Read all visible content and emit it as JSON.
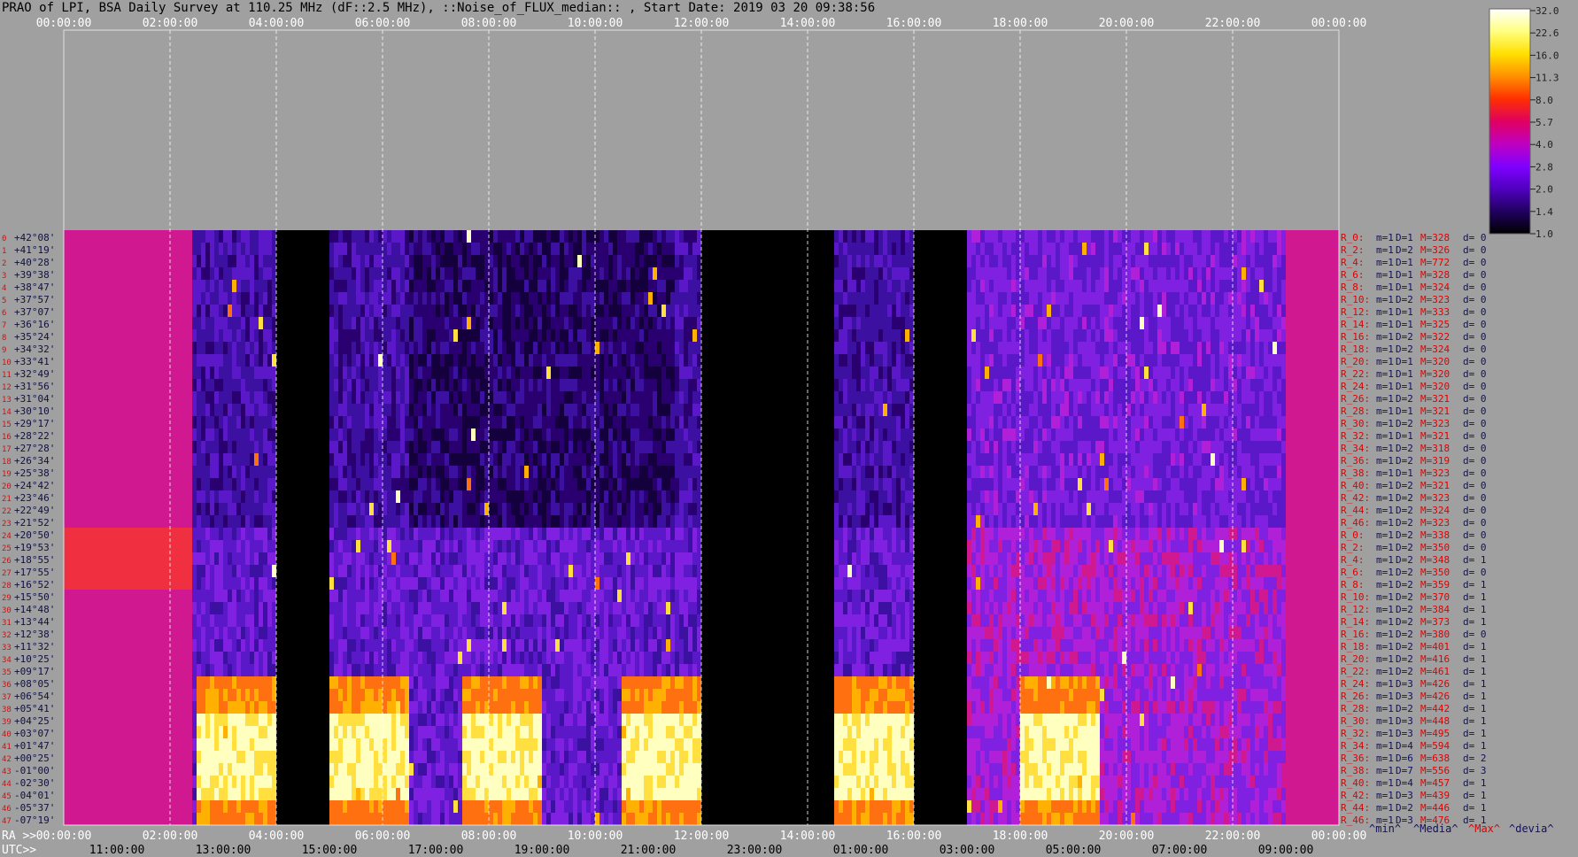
{
  "title": "PRAO of LPI, BSA Daily Survey at 110.25 MHz (dF::2.5 MHz), ::Noise_of_FLUX_median:: , Start Date: 2019 03 20 09:38:56",
  "chart_data": {
    "type": "heatmap",
    "utc_ticks_top": [
      "00:00:00",
      "02:00:00",
      "04:00:00",
      "06:00:00",
      "08:00:00",
      "10:00:00",
      "12:00:00",
      "14:00:00",
      "16:00:00",
      "18:00:00",
      "20:00:00",
      "22:00:00",
      "00:00:00"
    ],
    "ra_prefix": "RA >>",
    "ra_ticks": [
      "00:00:00",
      "02:00:00",
      "04:00:00",
      "06:00:00",
      "08:00:00",
      "10:00:00",
      "12:00:00",
      "14:00:00",
      "16:00:00",
      "18:00:00",
      "20:00:00",
      "22:00:00",
      "00:00:00"
    ],
    "utc_prefix": "UTC>>",
    "utc_ticks_bottom": [
      "11:00:00",
      "13:00:00",
      "15:00:00",
      "17:00:00",
      "19:00:00",
      "21:00:00",
      "23:00:00",
      "01:00:00",
      "03:00:00",
      "05:00:00",
      "07:00:00",
      "09:00:00"
    ],
    "declinations": [
      "+42°08'",
      "+41°19'",
      "+40°28'",
      "+39°38'",
      "+38°47'",
      "+37°57'",
      "+37°07'",
      "+36°16'",
      "+35°24'",
      "+34°32'",
      "+33°41'",
      "+32°49'",
      "+31°56'",
      "+31°04'",
      "+30°10'",
      "+29°17'",
      "+28°22'",
      "+27°28'",
      "+26°34'",
      "+25°38'",
      "+24°42'",
      "+23°46'",
      "+22°49'",
      "+21°52'",
      "+20°50'",
      "+19°53'",
      "+18°55'",
      "+17°55'",
      "+16°52'",
      "+15°50'",
      "+14°48'",
      "+13°44'",
      "+12°38'",
      "+11°32'",
      "+10°25'",
      "+09°17'",
      "+08°05'",
      "+06°54'",
      "+05°41'",
      "+04°25'",
      "+03°07'",
      "+01°47'",
      "+00°25'",
      "-01°00'",
      "-02°30'",
      "-04°01'",
      "-05°37'",
      "-07°19'"
    ],
    "row_indices": [
      "0",
      "1",
      "2",
      "3",
      "4",
      "5",
      "6",
      "7",
      "8",
      "9",
      "10",
      "11",
      "12",
      "13",
      "14",
      "15",
      "16",
      "17",
      "18",
      "19",
      "20",
      "21",
      "22",
      "23",
      "24",
      "25",
      "26",
      "27",
      "28",
      "29",
      "30",
      "31",
      "32",
      "33",
      "34",
      "35",
      "36",
      "37",
      "38",
      "39",
      "40",
      "41",
      "42",
      "43",
      "44",
      "45",
      "46",
      "47"
    ],
    "beam_stats": [
      {
        "r": "R_0:",
        "m": "m=1",
        "D": "D=1",
        "M": "M=328",
        "d": "d= 0"
      },
      {
        "r": "R_2:",
        "m": "m=1",
        "D": "D=2",
        "M": "M=326",
        "d": "d= 0"
      },
      {
        "r": "R_4:",
        "m": "m=1",
        "D": "D=1",
        "M": "M=772",
        "d": "d= 0"
      },
      {
        "r": "R_6:",
        "m": "m=1",
        "D": "D=1",
        "M": "M=328",
        "d": "d= 0"
      },
      {
        "r": "R_8:",
        "m": "m=1",
        "D": "D=1",
        "M": "M=324",
        "d": "d= 0"
      },
      {
        "r": "R_10:",
        "m": "m=1",
        "D": "D=2",
        "M": "M=323",
        "d": "d= 0"
      },
      {
        "r": "R_12:",
        "m": "m=1",
        "D": "D=1",
        "M": "M=333",
        "d": "d= 0"
      },
      {
        "r": "R_14:",
        "m": "m=1",
        "D": "D=1",
        "M": "M=325",
        "d": "d= 0"
      },
      {
        "r": "R_16:",
        "m": "m=1",
        "D": "D=2",
        "M": "M=322",
        "d": "d= 0"
      },
      {
        "r": "R_18:",
        "m": "m=1",
        "D": "D=2",
        "M": "M=324",
        "d": "d= 0"
      },
      {
        "r": "R_20:",
        "m": "m=1",
        "D": "D=1",
        "M": "M=320",
        "d": "d= 0"
      },
      {
        "r": "R_22:",
        "m": "m=1",
        "D": "D=1",
        "M": "M=320",
        "d": "d= 0"
      },
      {
        "r": "R_24:",
        "m": "m=1",
        "D": "D=1",
        "M": "M=320",
        "d": "d= 0"
      },
      {
        "r": "R_26:",
        "m": "m=1",
        "D": "D=2",
        "M": "M=321",
        "d": "d= 0"
      },
      {
        "r": "R_28:",
        "m": "m=1",
        "D": "D=1",
        "M": "M=321",
        "d": "d= 0"
      },
      {
        "r": "R_30:",
        "m": "m=1",
        "D": "D=2",
        "M": "M=323",
        "d": "d= 0"
      },
      {
        "r": "R_32:",
        "m": "m=1",
        "D": "D=1",
        "M": "M=321",
        "d": "d= 0"
      },
      {
        "r": "R_34:",
        "m": "m=1",
        "D": "D=2",
        "M": "M=318",
        "d": "d= 0"
      },
      {
        "r": "R_36:",
        "m": "m=1",
        "D": "D=2",
        "M": "M=319",
        "d": "d= 0"
      },
      {
        "r": "R_38:",
        "m": "m=1",
        "D": "D=1",
        "M": "M=323",
        "d": "d= 0"
      },
      {
        "r": "R_40:",
        "m": "m=1",
        "D": "D=2",
        "M": "M=321",
        "d": "d= 0"
      },
      {
        "r": "R_42:",
        "m": "m=1",
        "D": "D=2",
        "M": "M=323",
        "d": "d= 0"
      },
      {
        "r": "R_44:",
        "m": "m=1",
        "D": "D=2",
        "M": "M=324",
        "d": "d= 0"
      },
      {
        "r": "R_46:",
        "m": "m=1",
        "D": "D=2",
        "M": "M=323",
        "d": "d= 0"
      },
      {
        "r": "R_0:",
        "m": "m=1",
        "D": "D=2",
        "M": "M=338",
        "d": "d= 0"
      },
      {
        "r": "R_2:",
        "m": "m=1",
        "D": "D=2",
        "M": "M=350",
        "d": "d= 0"
      },
      {
        "r": "R_4:",
        "m": "m=1",
        "D": "D=2",
        "M": "M=348",
        "d": "d= 1"
      },
      {
        "r": "R_6:",
        "m": "m=1",
        "D": "D=2",
        "M": "M=350",
        "d": "d= 0"
      },
      {
        "r": "R_8:",
        "m": "m=1",
        "D": "D=2",
        "M": "M=359",
        "d": "d= 1"
      },
      {
        "r": "R_10:",
        "m": "m=1",
        "D": "D=2",
        "M": "M=370",
        "d": "d= 1"
      },
      {
        "r": "R_12:",
        "m": "m=1",
        "D": "D=2",
        "M": "M=384",
        "d": "d= 1"
      },
      {
        "r": "R_14:",
        "m": "m=1",
        "D": "D=2",
        "M": "M=373",
        "d": "d= 1"
      },
      {
        "r": "R_16:",
        "m": "m=1",
        "D": "D=2",
        "M": "M=380",
        "d": "d= 0"
      },
      {
        "r": "R_18:",
        "m": "m=1",
        "D": "D=2",
        "M": "M=401",
        "d": "d= 1"
      },
      {
        "r": "R_20:",
        "m": "m=1",
        "D": "D=2",
        "M": "M=416",
        "d": "d= 1"
      },
      {
        "r": "R_22:",
        "m": "m=1",
        "D": "D=2",
        "M": "M=461",
        "d": "d= 1"
      },
      {
        "r": "R_24:",
        "m": "m=1",
        "D": "D=3",
        "M": "M=426",
        "d": "d= 1"
      },
      {
        "r": "R_26:",
        "m": "m=1",
        "D": "D=3",
        "M": "M=426",
        "d": "d= 1"
      },
      {
        "r": "R_28:",
        "m": "m=1",
        "D": "D=2",
        "M": "M=442",
        "d": "d= 1"
      },
      {
        "r": "R_30:",
        "m": "m=1",
        "D": "D=3",
        "M": "M=448",
        "d": "d= 1"
      },
      {
        "r": "R_32:",
        "m": "m=1",
        "D": "D=3",
        "M": "M=495",
        "d": "d= 1"
      },
      {
        "r": "R_34:",
        "m": "m=1",
        "D": "D=4",
        "M": "M=594",
        "d": "d= 1"
      },
      {
        "r": "R_36:",
        "m": "m=1",
        "D": "D=6",
        "M": "M=638",
        "d": "d= 2"
      },
      {
        "r": "R_38:",
        "m": "m=1",
        "D": "D=7",
        "M": "M=556",
        "d": "d= 3"
      },
      {
        "r": "R_40:",
        "m": "m=1",
        "D": "D=4",
        "M": "M=457",
        "d": "d= 1"
      },
      {
        "r": "R_42:",
        "m": "m=1",
        "D": "D=3",
        "M": "M=439",
        "d": "d= 1"
      },
      {
        "r": "R_44:",
        "m": "m=1",
        "D": "D=2",
        "M": "M=446",
        "d": "d= 1"
      },
      {
        "r": "R_46:",
        "m": "m=1",
        "D": "D=3",
        "M": "M=476",
        "d": "d= 1"
      }
    ],
    "stats_legend": {
      "min": "^min^",
      "median": "^Media^",
      "max": "^Max^",
      "dev": "^devia^"
    },
    "colorbar": {
      "ticks": [
        "32.0",
        "22.6",
        "16.0",
        "11.3",
        "8.0",
        "5.7",
        "4.0",
        "2.8",
        "2.0",
        "1.4",
        "1.0"
      ],
      "colors": [
        "#ffffff",
        "#ffff80",
        "#ffe000",
        "#ff9000",
        "#ff3000",
        "#e00060",
        "#c000c0",
        "#8000ff",
        "#5000c0",
        "#200060",
        "#000000"
      ]
    },
    "dropouts_utc_hours": [
      [
        4.0,
        5.0
      ],
      [
        12.0,
        14.5
      ],
      [
        16.0,
        17.0
      ]
    ],
    "bright_source_utc_hours": [
      [
        2.5,
        4.0
      ],
      [
        5.0,
        6.5
      ],
      [
        7.5,
        9.0
      ],
      [
        10.5,
        12.0
      ],
      [
        14.5,
        16.0
      ],
      [
        18.0,
        19.5
      ]
    ]
  }
}
